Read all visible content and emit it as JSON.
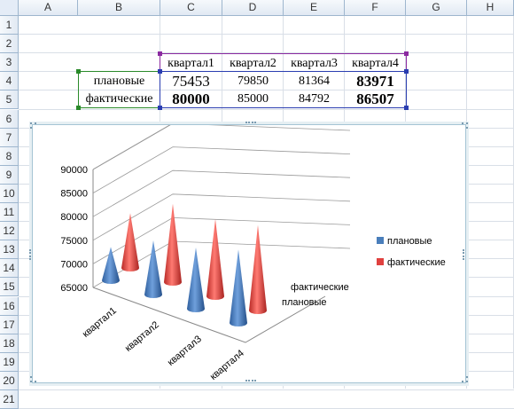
{
  "columns": [
    "A",
    "B",
    "C",
    "D",
    "E",
    "F",
    "G",
    "H"
  ],
  "rows": [
    "1",
    "2",
    "3",
    "4",
    "5",
    "6",
    "7",
    "8",
    "9",
    "10",
    "11",
    "12",
    "13",
    "14",
    "15",
    "16",
    "17",
    "18",
    "19",
    "20",
    "21"
  ],
  "table": {
    "headers": [
      "квартал1",
      "квартал2",
      "квартал3",
      "квартал4"
    ],
    "row1": {
      "label": "плановые",
      "values": [
        "75453",
        "79850",
        "81364",
        "83971"
      ]
    },
    "row2": {
      "label": "фактические",
      "values": [
        "80000",
        "85000",
        "84792",
        "86507"
      ]
    }
  },
  "chart_data": {
    "type": "bar",
    "subtype": "3d-cone",
    "categories": [
      "квартал1",
      "квартал2",
      "квартал3",
      "квартал4"
    ],
    "series": [
      {
        "name": "плановые",
        "values": [
          75453,
          79850,
          81364,
          83971
        ],
        "color": "#4a7ebb"
      },
      {
        "name": "фактические",
        "values": [
          80000,
          85000,
          84792,
          86507
        ],
        "color": "#e0413f"
      }
    ],
    "y_ticks": [
      "90000",
      "85000",
      "80000",
      "75000",
      "70000",
      "65000"
    ],
    "ylim": [
      65000,
      90000
    ],
    "depth_labels": [
      "фактические",
      "плановые"
    ],
    "legend": "right",
    "grid": true
  }
}
